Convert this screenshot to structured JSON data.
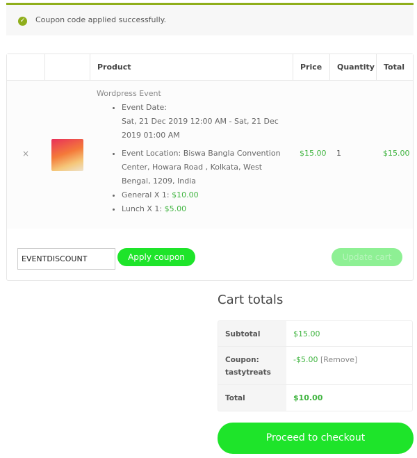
{
  "notice": {
    "icon": "check-circle-icon",
    "message": "Coupon code applied successfully."
  },
  "cart": {
    "headers": [
      "",
      "",
      "Product",
      "Price",
      "Quantity",
      "Total"
    ],
    "item": {
      "remove": "×",
      "image": "product-thumbnail",
      "name": "Wordpress Event",
      "event_date_label": "Event Date:",
      "event_date": "Sat, 21 Dec 2019 12:00 AM - Sat, 21 Dec 2019 01:00 AM",
      "event_location": "Event Location: Biswa Bangla Convention Center, Howara Road , Kolkata, West Bengal, 1209, India",
      "general_label": "General X 1: ",
      "general_price": "$10.00",
      "lunch_label": "Lunch X 1: ",
      "lunch_price": "$5.00",
      "price": "$15.00",
      "quantity": "1",
      "total": "$15.00"
    },
    "coupon_value": "EVENTDISCOUNT",
    "apply_label": "Apply coupon",
    "update_label": "Update cart"
  },
  "totals": {
    "title": "Cart totals",
    "subtotal_label": "Subtotal",
    "subtotal": "$15.00",
    "coupon_label": "Coupon: tastytreats",
    "coupon_value": "-$5.00",
    "remove_label": "[Remove]",
    "total_label": "Total",
    "total": "$10.00",
    "checkout_label": "Proceed to checkout"
  },
  "colors": {
    "accent": "#1ee42a",
    "price": "#3fb43f",
    "notice_border": "#8fae1b"
  }
}
